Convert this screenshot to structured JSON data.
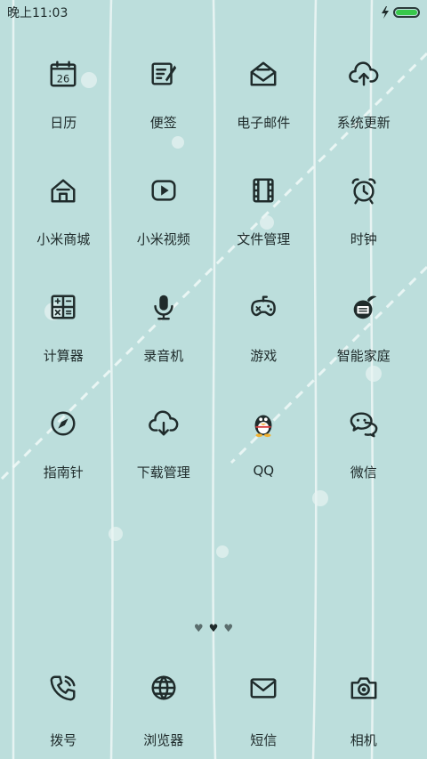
{
  "status_bar": {
    "time": "晚上11:03",
    "charging_icon": "lightning-icon",
    "battery_level": 1.0,
    "battery_color": "#37c84a"
  },
  "apps": [
    {
      "label": "日历",
      "icon": "calendar-icon",
      "calendar_day": "26"
    },
    {
      "label": "便签",
      "icon": "notes-icon"
    },
    {
      "label": "电子邮件",
      "icon": "email-icon"
    },
    {
      "label": "系统更新",
      "icon": "cloud-upload-icon"
    },
    {
      "label": "小米商城",
      "icon": "store-icon"
    },
    {
      "label": "小米视频",
      "icon": "video-play-icon"
    },
    {
      "label": "文件管理",
      "icon": "file-manager-icon"
    },
    {
      "label": "时钟",
      "icon": "alarm-clock-icon"
    },
    {
      "label": "计算器",
      "icon": "calculator-icon"
    },
    {
      "label": "录音机",
      "icon": "microphone-icon"
    },
    {
      "label": "游戏",
      "icon": "gamepad-icon"
    },
    {
      "label": "智能家庭",
      "icon": "smart-home-icon"
    },
    {
      "label": "指南针",
      "icon": "compass-icon"
    },
    {
      "label": "下载管理",
      "icon": "cloud-download-icon"
    },
    {
      "label": "QQ",
      "icon": "qq-penguin-icon"
    },
    {
      "label": "微信",
      "icon": "wechat-icon"
    }
  ],
  "page_indicator": {
    "count": 3,
    "active_index": 1
  },
  "dock": [
    {
      "label": "拨号",
      "icon": "phone-icon"
    },
    {
      "label": "浏览器",
      "icon": "browser-globe-icon"
    },
    {
      "label": "短信",
      "icon": "message-icon"
    },
    {
      "label": "相机",
      "icon": "camera-icon"
    }
  ],
  "colors": {
    "wallpaper": "#bcdedc",
    "icon_stroke": "#1f2b2b",
    "label_text": "#1e2a2a"
  }
}
